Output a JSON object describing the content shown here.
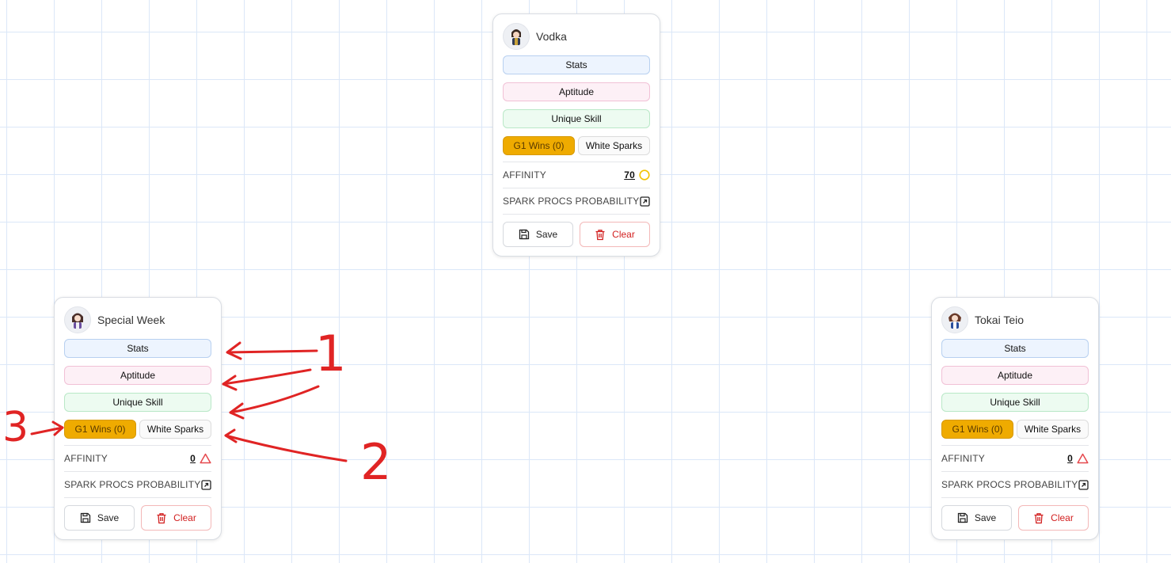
{
  "cards": [
    {
      "name": "Vodka",
      "stats_label": "Stats",
      "aptitude_label": "Aptitude",
      "unique_skill_label": "Unique Skill",
      "g1_label": "G1 Wins (0)",
      "white_sparks_label": "White Sparks",
      "affinity_label": "AFFINITY",
      "affinity_value": "70",
      "affinity_icon": "circle-icon",
      "spark_label": "SPARK PROCS PROBABILITY",
      "save_label": "Save",
      "clear_label": "Clear"
    },
    {
      "name": "Special Week",
      "stats_label": "Stats",
      "aptitude_label": "Aptitude",
      "unique_skill_label": "Unique Skill",
      "g1_label": "G1 Wins (0)",
      "white_sparks_label": "White Sparks",
      "affinity_label": "AFFINITY",
      "affinity_value": "0",
      "affinity_icon": "triangle-icon",
      "spark_label": "SPARK PROCS PROBABILITY",
      "save_label": "Save",
      "clear_label": "Clear"
    },
    {
      "name": "Tokai Teio",
      "stats_label": "Stats",
      "aptitude_label": "Aptitude",
      "unique_skill_label": "Unique Skill",
      "g1_label": "G1 Wins (0)",
      "white_sparks_label": "White Sparks",
      "affinity_label": "AFFINITY",
      "affinity_value": "0",
      "affinity_icon": "triangle-icon",
      "spark_label": "SPARK PROCS PROBABILITY",
      "save_label": "Save",
      "clear_label": "Clear"
    }
  ],
  "annotations": {
    "label_1": "1",
    "label_2": "2",
    "label_3": "3",
    "color": "#e02424"
  },
  "colors": {
    "g1_accent": "#efab00",
    "clear_red": "#d21f1f",
    "affinity_circle": "#f2c200",
    "affinity_triangle": "#e5484d"
  }
}
